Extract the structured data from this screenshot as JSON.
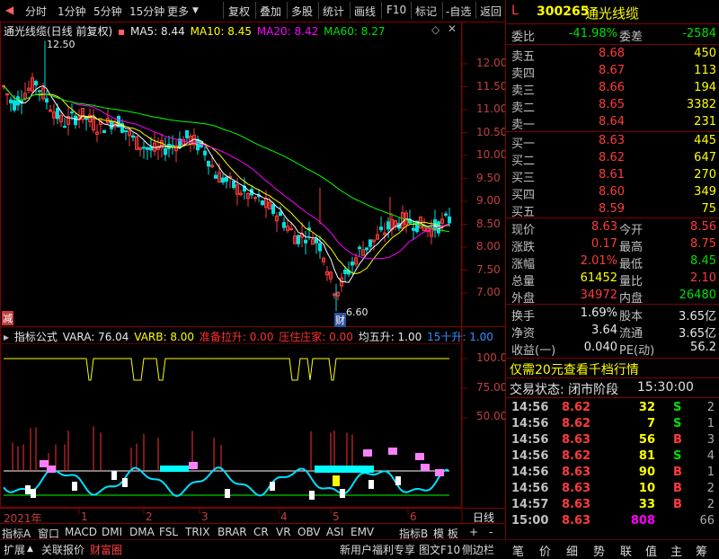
{
  "toolbar": {
    "left_items": [
      "分时",
      "1分钟",
      "5分钟",
      "15分钟",
      "更多"
    ],
    "right_items": [
      "复权",
      "叠加",
      "多股",
      "统计",
      "画线",
      "F10",
      "标记",
      "-自选",
      "返回"
    ]
  },
  "main_chart": {
    "title": "通光线缆(日线 前复权)",
    "ma5": "MA5: 8.44",
    "ma10": "MA10: 8.45",
    "ma20": "MA20: 8.42",
    "ma60": "MA60: 8.27",
    "high_mark": "12.50",
    "low_mark": "6.60",
    "left_flag": "减",
    "low_flag": "财",
    "price_ticks": [
      "12.00",
      "11.50",
      "11.00",
      "10.50",
      "10.00",
      "9.50",
      "9.00",
      "8.50",
      "8.00",
      "7.50",
      "7.00"
    ]
  },
  "indicator": {
    "title": "指标公式",
    "vara": "VARA: 76.04",
    "varb": "VARB: 8.00",
    "l1": "准备拉升: 0.00",
    "l2": "压住庄家: 0.00",
    "l3": "均五升: 1.00",
    "l4": "15十升: 1.00",
    "ticks": [
      "100.0",
      "75.00",
      "50.00"
    ]
  },
  "time_axis": {
    "labels": [
      "2021年",
      "1",
      "2",
      "3",
      "4",
      "5",
      "6"
    ],
    "right_label": "日线"
  },
  "bottom_tabs": [
    "指标A",
    "窗口",
    "MACD",
    "DMI",
    "DMA",
    "FSL",
    "TRIX",
    "BRAR",
    "CR",
    "VR",
    "OBV",
    "ASI",
    "EMV"
  ],
  "bottom_right_tabs": [
    "指标B",
    "模 板",
    "+",
    "-"
  ],
  "status_bar": {
    "expand": "扩展",
    "quote": "关联报价",
    "wealth": "财富圈",
    "promo": "新用户福利专享",
    "f10": "图文F10",
    "side": "侧边栏"
  },
  "quote": {
    "flag": "L",
    "code": "300265",
    "name": "通光线缆",
    "weibi_label": "委比",
    "weibi": "-41.98%",
    "weicha_label": "委差",
    "weicha": "-2584",
    "asks": [
      {
        "label": "卖五",
        "price": "8.68",
        "vol": "450"
      },
      {
        "label": "卖四",
        "price": "8.67",
        "vol": "113"
      },
      {
        "label": "卖三",
        "price": "8.66",
        "vol": "194"
      },
      {
        "label": "卖二",
        "price": "8.65",
        "vol": "3382"
      },
      {
        "label": "卖一",
        "price": "8.64",
        "vol": "231"
      }
    ],
    "bids": [
      {
        "label": "买一",
        "price": "8.63",
        "vol": "445"
      },
      {
        "label": "买二",
        "price": "8.62",
        "vol": "647"
      },
      {
        "label": "买三",
        "price": "8.61",
        "vol": "270"
      },
      {
        "label": "买四",
        "price": "8.60",
        "vol": "349"
      },
      {
        "label": "买五",
        "price": "8.59",
        "vol": "75"
      }
    ],
    "stats": [
      {
        "l1": "现价",
        "v1": "8.63",
        "l2": "今开",
        "v2": "8.56"
      },
      {
        "l1": "涨跌",
        "v1": "0.17",
        "l2": "最高",
        "v2": "8.75"
      },
      {
        "l1": "涨幅",
        "v1": "2.01%",
        "l2": "最低",
        "v2": "8.45"
      },
      {
        "l1": "总量",
        "v1": "61452",
        "l2": "量比",
        "v2": "2.10"
      },
      {
        "l1": "外盘",
        "v1": "34972",
        "l2": "内盘",
        "v2": "26480"
      }
    ],
    "extra": [
      {
        "l1": "换手",
        "v1": "1.69%",
        "l2": "股本",
        "v2": "3.65亿"
      },
      {
        "l1": "净资",
        "v1": "3.64",
        "l2": "流通",
        "v2": "3.65亿"
      },
      {
        "l1": "收益(一)",
        "v1": "0.040",
        "l2": "PE(动)",
        "v2": "56.2"
      }
    ],
    "promo": "仅需20元查看千档行情",
    "state_label": "交易状态: 闭市阶段",
    "state_time": "15:30:00",
    "trades": [
      {
        "t": "14:56",
        "p": "8.62",
        "v": "32",
        "d": "S",
        "n": "2"
      },
      {
        "t": "14:56",
        "p": "8.62",
        "v": "7",
        "d": "S",
        "n": "1"
      },
      {
        "t": "14:56",
        "p": "8.63",
        "v": "56",
        "d": "B",
        "n": "3"
      },
      {
        "t": "14:56",
        "p": "8.62",
        "v": "81",
        "d": "S",
        "n": "4"
      },
      {
        "t": "14:56",
        "p": "8.63",
        "v": "90",
        "d": "B",
        "n": "1"
      },
      {
        "t": "14:56",
        "p": "8.63",
        "v": "10",
        "d": "B",
        "n": "2"
      },
      {
        "t": "14:57",
        "p": "8.63",
        "v": "33",
        "d": "B",
        "n": "2"
      },
      {
        "t": "15:00",
        "p": "8.63",
        "v": "808",
        "d": "",
        "n": "66"
      }
    ]
  },
  "panel_nav": [
    "笔",
    "价",
    "细",
    "势",
    "联",
    "值",
    "主",
    "筹"
  ],
  "colors": {
    "up": "#ff3b3b",
    "down": "#00e000",
    "frame": "#800000",
    "ma5": "#ffffff",
    "ma10": "#ffff00",
    "ma20": "#ff00ff",
    "ma60": "#00ff00"
  }
}
